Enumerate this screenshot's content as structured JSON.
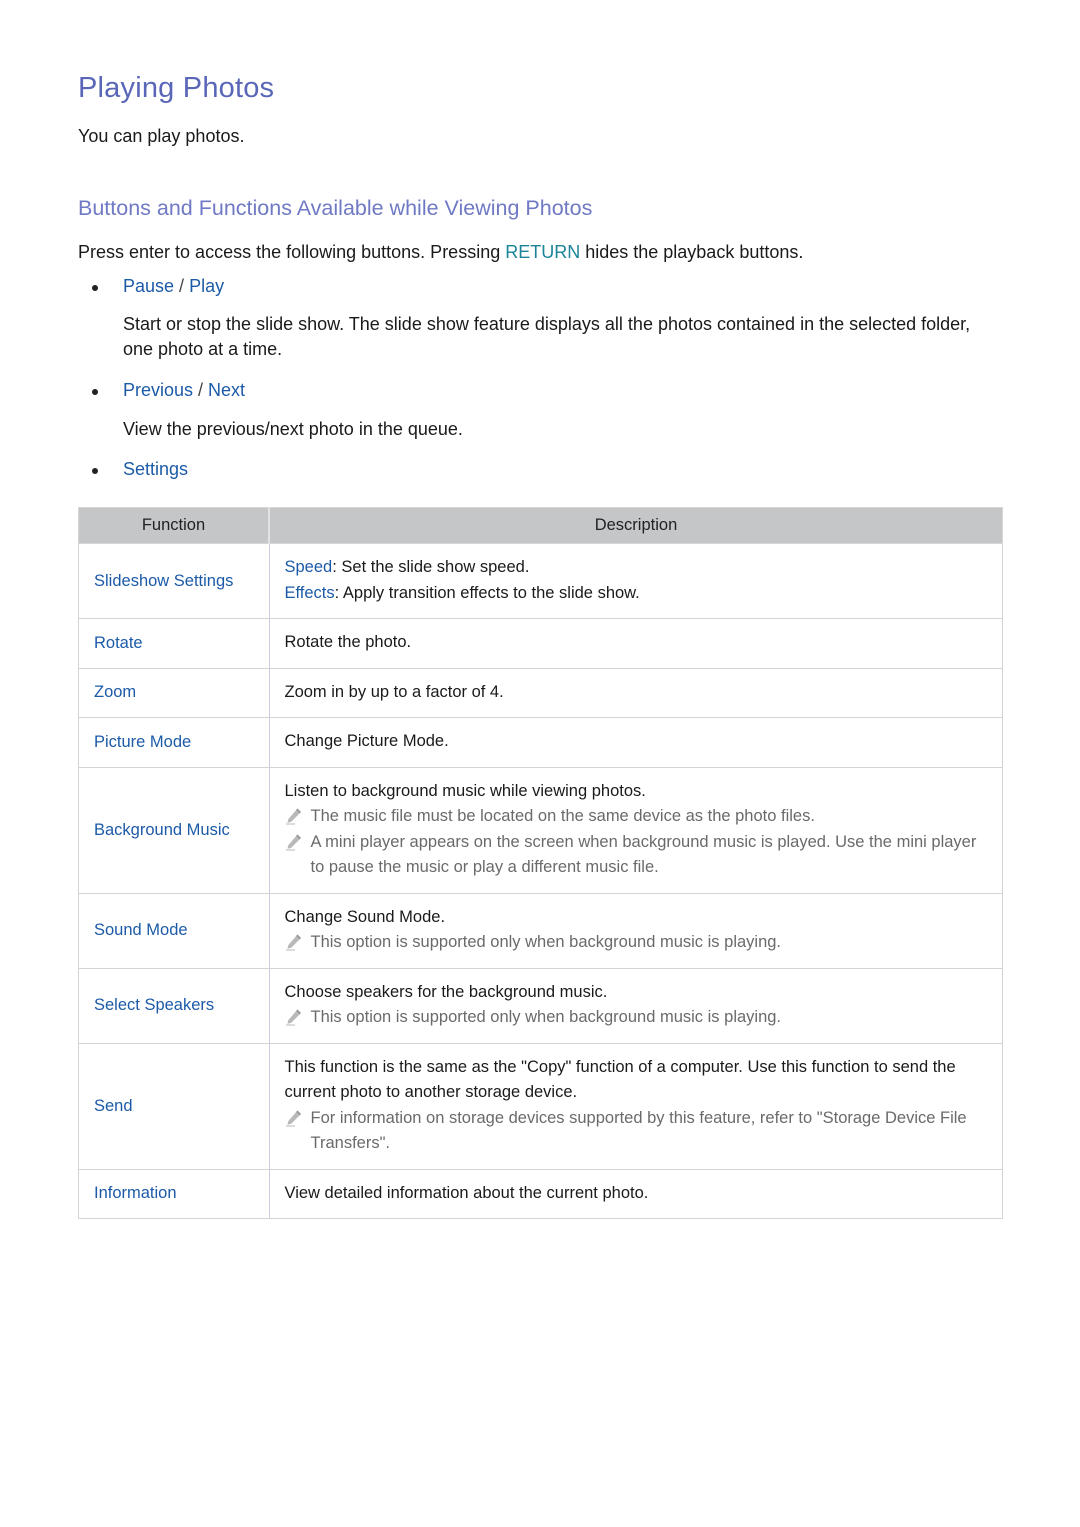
{
  "title": "Playing Photos",
  "intro": "You can play photos.",
  "section_title": "Buttons and Functions Available while Viewing Photos",
  "lead": {
    "before": "Press enter to access the following buttons. Pressing ",
    "keyword": "RETURN",
    "after": " hides the playback buttons."
  },
  "bullets": [
    {
      "label_a": "Pause",
      "separator": " / ",
      "label_b": "Play",
      "description": "Start or stop the slide show. The slide show feature displays all the photos contained in the selected folder, one photo at a time."
    },
    {
      "label_a": "Previous",
      "separator": " / ",
      "label_b": "Next",
      "description": "View the previous/next photo in the queue."
    },
    {
      "label_a": "Settings"
    }
  ],
  "table": {
    "headers": [
      "Function",
      "Description"
    ],
    "rows": [
      {
        "function": "Slideshow Settings",
        "lines": [
          {
            "key": "Speed",
            "text": ": Set the slide show speed."
          },
          {
            "key": "Effects",
            "text": ": Apply transition effects to the slide show."
          }
        ]
      },
      {
        "function": "Rotate",
        "text": "Rotate the photo."
      },
      {
        "function": "Zoom",
        "text": "Zoom in by up to a factor of 4."
      },
      {
        "function": "Picture Mode",
        "text": "Change Picture Mode."
      },
      {
        "function": "Background Music",
        "text": "Listen to background music while viewing photos.",
        "notes": [
          "The music file must be located on the same device as the photo files.",
          "A mini player appears on the screen when background music is played. Use the mini player to pause the music or play a different music file."
        ]
      },
      {
        "function": "Sound Mode",
        "text": "Change Sound Mode.",
        "notes": [
          "This option is supported only when background music is playing."
        ]
      },
      {
        "function": "Select Speakers",
        "text": "Choose speakers for the background music.",
        "notes": [
          "This option is supported only when background music is playing."
        ]
      },
      {
        "function": "Send",
        "text": "This function is the same as the \"Copy\" function of a computer. Use this function to send the current photo to another storage device.",
        "notes": [
          "For information on storage devices supported by this feature, refer to \"Storage Device File Transfers\"."
        ]
      },
      {
        "function": "Information",
        "text": "View detailed information about the current photo."
      }
    ]
  },
  "icons": {
    "note": "pencil-icon",
    "bullet": "bullet-dot"
  },
  "colors": {
    "title": "#5a67b8",
    "section": "#6f79c4",
    "link": "#1c5aa8",
    "keyword": "#1b8496",
    "note": "#6a6a6a",
    "header_bg": "#c4c6c8"
  }
}
